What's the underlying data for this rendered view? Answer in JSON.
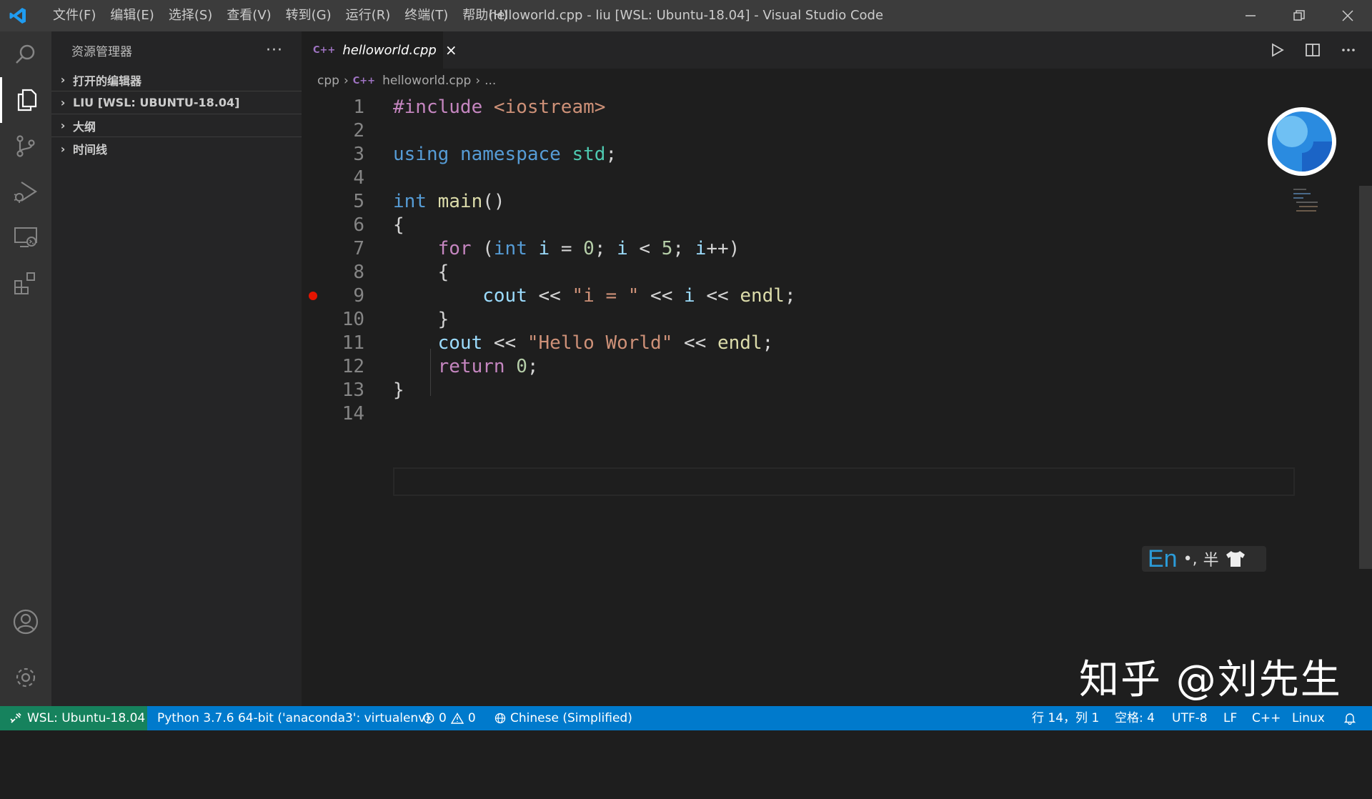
{
  "colors": {
    "titlebar": "#3c3c3c",
    "activitybar": "#333333",
    "sidebar": "#252526",
    "editor": "#1e1e1e",
    "statusbar": "#007acc",
    "remote": "#16825d",
    "breakpoint": "#e51400"
  },
  "titlebar": {
    "logo_icon": "vscode-logo-icon",
    "menu": [
      "文件(F)",
      "编辑(E)",
      "选择(S)",
      "查看(V)",
      "转到(G)",
      "运行(R)",
      "终端(T)",
      "帮助(H)"
    ],
    "title": "helloworld.cpp - liu [WSL: Ubuntu-18.04] - Visual Studio Code"
  },
  "activitybar": {
    "top": [
      "search-icon",
      "explorer-icon",
      "source-control-icon",
      "run-debug-icon",
      "remote-explorer-icon",
      "extensions-icon"
    ],
    "bottom": [
      "account-icon",
      "settings-gear-icon"
    ]
  },
  "sidebar": {
    "title": "资源管理器",
    "more": "···",
    "sections": [
      "打开的编辑器",
      "LIU [WSL: UBUNTU-18.04]",
      "大纲",
      "时间线"
    ]
  },
  "tabs": [
    {
      "icon_text": "C++",
      "label": "helloworld.cpp",
      "close": "×"
    }
  ],
  "breadcrumb": {
    "folder": "cpp",
    "file_icon": "C++",
    "file": "helloworld.cpp",
    "tail": "..."
  },
  "editor": {
    "breakpoint_line": 9,
    "lines": [
      {
        "n": "1",
        "tokens": [
          [
            "k-dir",
            "#include"
          ],
          [
            "k-p",
            " "
          ],
          [
            "k-inc",
            "<iostream>"
          ]
        ]
      },
      {
        "n": "2",
        "tokens": []
      },
      {
        "n": "3",
        "tokens": [
          [
            "k-kw",
            "using"
          ],
          [
            "k-p",
            " "
          ],
          [
            "k-kw",
            "namespace"
          ],
          [
            "k-p",
            " "
          ],
          [
            "k-ns",
            "std"
          ],
          [
            "k-p",
            ";"
          ]
        ]
      },
      {
        "n": "4",
        "tokens": []
      },
      {
        "n": "5",
        "tokens": [
          [
            "k-kw",
            "int"
          ],
          [
            "k-p",
            " "
          ],
          [
            "k-fn",
            "main"
          ],
          [
            "k-p",
            "()"
          ]
        ]
      },
      {
        "n": "6",
        "tokens": [
          [
            "k-p",
            "{"
          ]
        ]
      },
      {
        "n": "7",
        "tokens": [
          [
            "k-p",
            "    "
          ],
          [
            "k-ctl",
            "for"
          ],
          [
            "k-p",
            " ("
          ],
          [
            "k-kw",
            "int"
          ],
          [
            "k-p",
            " "
          ],
          [
            "k-var",
            "i"
          ],
          [
            "k-p",
            " = "
          ],
          [
            "k-num",
            "0"
          ],
          [
            "k-p",
            "; "
          ],
          [
            "k-var",
            "i"
          ],
          [
            "k-p",
            " < "
          ],
          [
            "k-num",
            "5"
          ],
          [
            "k-p",
            "; "
          ],
          [
            "k-var",
            "i"
          ],
          [
            "k-p",
            "++)"
          ]
        ]
      },
      {
        "n": "8",
        "tokens": [
          [
            "k-p",
            "    {"
          ]
        ]
      },
      {
        "n": "9",
        "tokens": [
          [
            "k-p",
            "        "
          ],
          [
            "k-var",
            "cout"
          ],
          [
            "k-p",
            " << "
          ],
          [
            "k-str",
            "\"i = \""
          ],
          [
            "k-p",
            " << "
          ],
          [
            "k-var",
            "i"
          ],
          [
            "k-p",
            " << "
          ],
          [
            "k-fn",
            "endl"
          ],
          [
            "k-p",
            ";"
          ]
        ]
      },
      {
        "n": "10",
        "tokens": [
          [
            "k-p",
            "    }"
          ]
        ]
      },
      {
        "n": "11",
        "tokens": [
          [
            "k-p",
            "    "
          ],
          [
            "k-var",
            "cout"
          ],
          [
            "k-p",
            " << "
          ],
          [
            "k-str",
            "\"Hello World\""
          ],
          [
            "k-p",
            " << "
          ],
          [
            "k-fn",
            "endl"
          ],
          [
            "k-p",
            ";"
          ]
        ]
      },
      {
        "n": "12",
        "tokens": [
          [
            "k-p",
            "    "
          ],
          [
            "k-ctl",
            "return"
          ],
          [
            "k-p",
            " "
          ],
          [
            "k-num",
            "0"
          ],
          [
            "k-p",
            ";"
          ]
        ]
      },
      {
        "n": "13",
        "tokens": [
          [
            "k-p",
            "}"
          ]
        ]
      },
      {
        "n": "14",
        "tokens": []
      }
    ]
  },
  "ime": {
    "mode": "En",
    "punct": "•,",
    "width": "半",
    "skin_icon": "shirt-icon"
  },
  "watermark": "知乎 @刘先生",
  "statusbar": {
    "remote": "WSL: Ubuntu-18.04",
    "python": "Python 3.7.6 64-bit ('anaconda3': virtualenv)",
    "errors": "0",
    "warnings": "0",
    "language_pack": "Chinese (Simplified)",
    "cursor": "行 14，列 1",
    "spaces": "空格: 4",
    "encoding": "UTF-8",
    "eol": "LF",
    "language": "C++",
    "platform": "Linux"
  }
}
